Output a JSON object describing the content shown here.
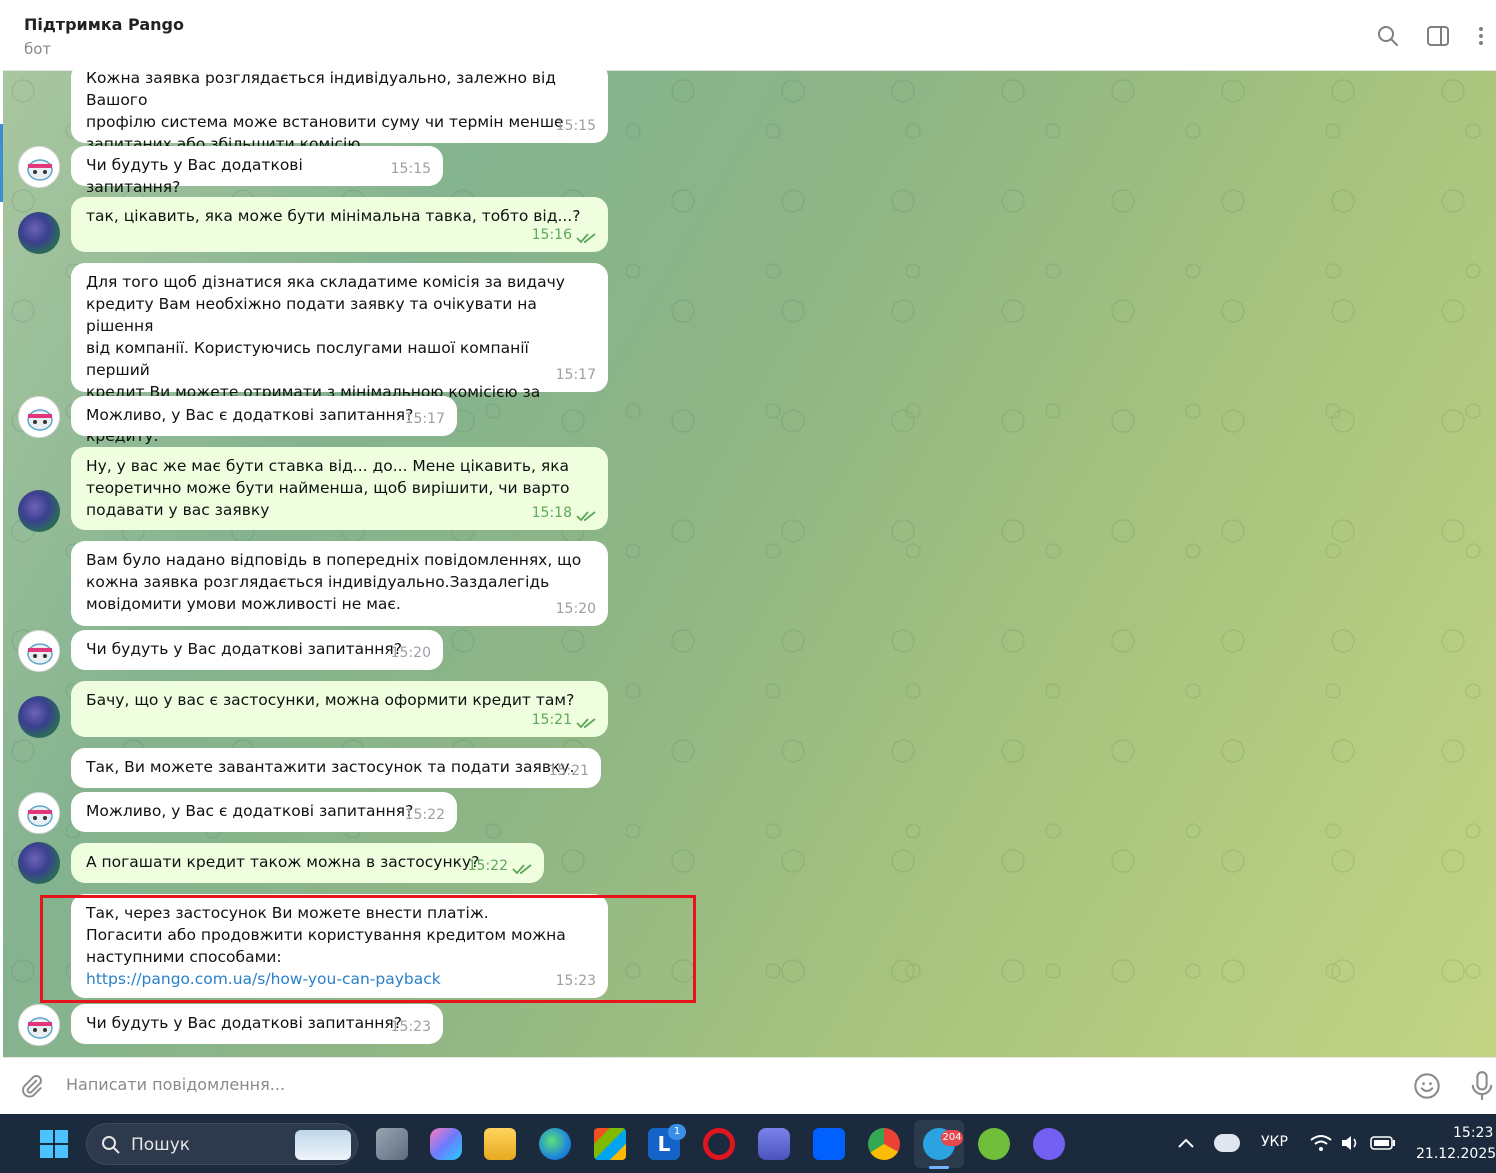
{
  "header": {
    "title": "Підтримка Pango",
    "subtitle": "бот"
  },
  "messages": [
    {
      "dir": "in",
      "text": "Кожна заявка розглядається індивідуально, залежно від Вашого\nпрофілю система може встановити суму чи термін менше\nзапитаних або збільшити комісію.",
      "time": "15:15"
    },
    {
      "dir": "in",
      "text": "Чи будуть у Вас додаткові запитання?",
      "time": "15:15"
    },
    {
      "dir": "out",
      "text": "так, цікавить, яка може бути мінімальна тавка, тобто від...?",
      "time": "15:16"
    },
    {
      "dir": "in",
      "text": "Для того щоб дізнатися яка складатиме комісія за видачу\nкредиту Вам необхіжно подати заявку та очікувати на рішення\nвід компанії. Користуючись послугами нашої компанії перший\nкредит Ви можете отримати з мінімальною комісією за видачу\nкредиту.",
      "time": "15:17"
    },
    {
      "dir": "in",
      "text": "Можливо, у Вас є додаткові запитання?",
      "time": "15:17"
    },
    {
      "dir": "out",
      "text": "Ну, у вас же має бути ставка від... до... Мене цікавить, яка\nтеоретично може бути найменша, щоб вирішити, чи варто\nподавати у вас заявку",
      "time": "15:18"
    },
    {
      "dir": "in",
      "text": "Вам було надано відповідь в попередніх повідомленнях, що\nкожна заявка розглядається індивідуально.Заздалегідь\nмовідомити умови можливості не має.",
      "time": "15:20"
    },
    {
      "dir": "in",
      "text": "Чи будуть у Вас додаткові запитання?",
      "time": "15:20"
    },
    {
      "dir": "out",
      "text": "Бачу, що у вас є застосунки, можна оформити кредит там?",
      "time": "15:21"
    },
    {
      "dir": "in",
      "text": "Так, Ви можете завантажити застосунок та подати заявку.",
      "time": "15:21"
    },
    {
      "dir": "in",
      "text": "Можливо, у Вас є додаткові запитання?",
      "time": "15:22"
    },
    {
      "dir": "out",
      "text": "А погашати кредит також можна в застосунку?",
      "time": "15:22"
    },
    {
      "dir": "in",
      "text": "Так, через застосунок Ви можете внести платіж.\nПогасити або продовжити користування кредитом можна\nнаступними способами:",
      "link": "https://pango.com.ua/s/how-you-can-payback",
      "time": "15:23"
    },
    {
      "dir": "in",
      "text": "Чи будуть у Вас додаткові запитання?",
      "time": "15:23"
    }
  ],
  "input": {
    "placeholder": "Написати повідомлення..."
  },
  "taskbar": {
    "search_label": "Пошук",
    "lang": "УКР",
    "time": "15:23",
    "date": "21.12.2025",
    "telegram_badge": "204",
    "l_badge": "1"
  },
  "colors": {
    "incoming_bubble": "#ffffff",
    "outgoing_bubble": "#eefedf",
    "outgoing_time": "#5fa85a",
    "link": "#2a7fc9",
    "highlight": "#e8141c",
    "taskbar": "#1c2a3d"
  },
  "icons": {
    "header": [
      "search-icon",
      "sidebar-toggle-icon",
      "more-vertical-icon"
    ],
    "input": [
      "attach-icon",
      "emoji-icon",
      "microphone-icon"
    ]
  }
}
